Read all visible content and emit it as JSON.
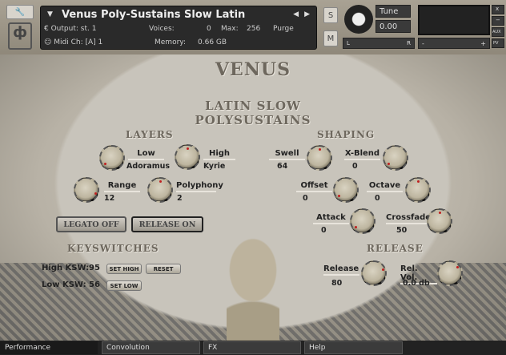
{
  "header": {
    "instrument_name": "Venus Poly-Sustains Slow Latin",
    "output_label": "Output:",
    "output_value": "st. 1",
    "midi_label": "Midi Ch:",
    "midi_value": "[A] 1",
    "voices_label": "Voices:",
    "voices_value": "0",
    "max_label": "Max:",
    "max_value": "256",
    "memory_label": "Memory:",
    "memory_value": "0.66 GB",
    "purge_label": "Purge",
    "solo": "S",
    "mute": "M",
    "tune_label": "Tune",
    "tune_value": "0.00",
    "pan_left": "L",
    "pan_right": "R",
    "vol_minus": "-",
    "vol_plus": "+",
    "close": "x",
    "minimize": "−",
    "aux": "AUX",
    "pv": "PV"
  },
  "brand": {
    "title": "VENUS",
    "subtitle1": "LATIN SLOW",
    "subtitle2": "POLYSUSTAINS"
  },
  "layers": {
    "title": "LAYERS",
    "low_label": "Low",
    "low_value": "Adoramus",
    "high_label": "High",
    "high_value": "Kyrie",
    "range_label": "Range",
    "range_value": "12",
    "polyphony_label": "Polyphony",
    "polyphony_value": "2"
  },
  "shaping": {
    "title": "SHAPING",
    "swell_label": "Swell",
    "swell_value": "64",
    "xblend_label": "X-Blend",
    "xblend_value": "0",
    "offset_label": "Offset",
    "offset_value": "0",
    "octave_label": "Octave",
    "octave_value": "0",
    "attack_label": "Attack",
    "attack_value": "0",
    "crossfade_label": "Crossfade",
    "crossfade_value": "50"
  },
  "buttons": {
    "legato": "LEGATO OFF",
    "release": "RELEASE ON"
  },
  "keyswitches": {
    "title": "KEYSWITCHES",
    "high_label": "High KSW:",
    "high_value": "95",
    "low_label": "Low KSW:",
    "low_value": "56",
    "set_high": "SET HIGH",
    "reset": "RESET",
    "set_low": "SET LOW"
  },
  "release": {
    "title": "RELEASE",
    "release_label": "Release",
    "release_value": "80",
    "relvol_label": "Rel. Vol.",
    "relvol_value": "0.0 db"
  },
  "tabs": [
    "Performance",
    "Convolution",
    "FX",
    "Help"
  ]
}
